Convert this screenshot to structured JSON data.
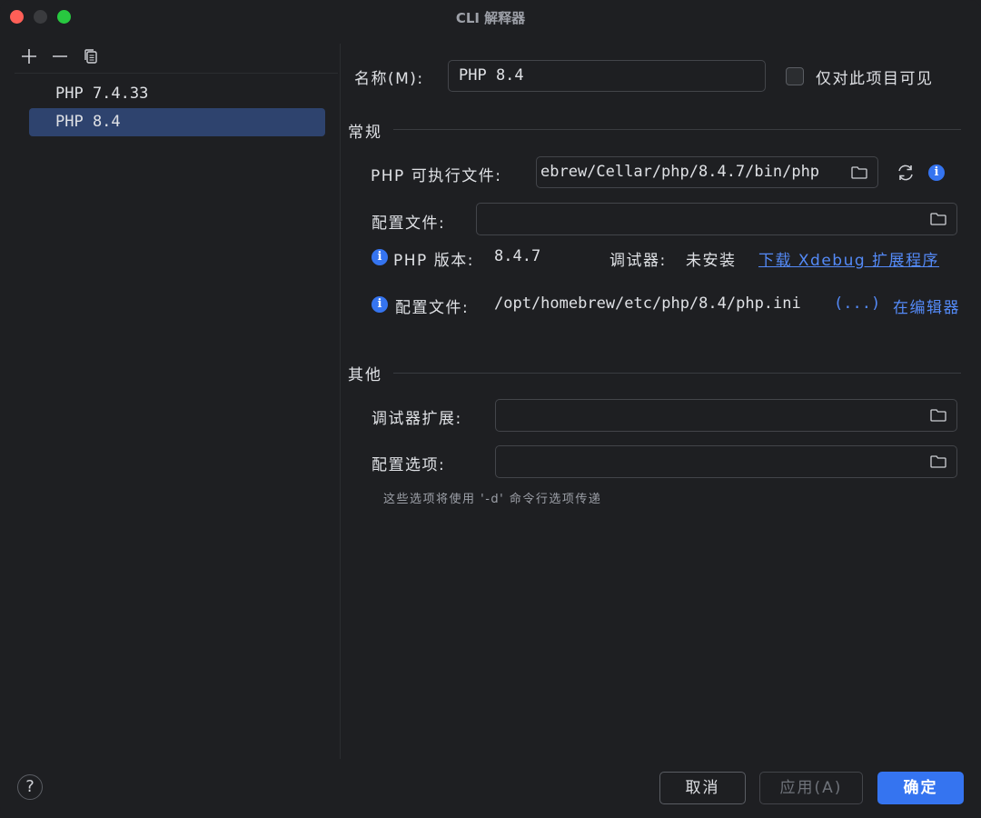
{
  "window": {
    "title": "CLI 解释器"
  },
  "left": {
    "toolbar": {
      "add": "+",
      "remove": "−"
    },
    "interpreters": [
      {
        "label": "PHP 7.4.33"
      },
      {
        "label": "PHP 8.4"
      }
    ],
    "selected_index": 1
  },
  "form": {
    "name_label": "名称(M):",
    "name_value": "PHP 8.4",
    "visible_only_label": "仅对此项目可见",
    "general_title": "常规",
    "php_exec_label": "PHP 可执行文件:",
    "php_exec_value": "ebrew/Cellar/php/8.4.7/bin/php",
    "config_file_label": "配置文件:",
    "config_file_value": "",
    "php_version_label": "PHP 版本:",
    "php_version_value": "8.4.7",
    "debugger_label": "调试器:",
    "debugger_value": "未安装",
    "download_link": "下载 Xdebug 扩展程序",
    "config_info_label": "配置文件:",
    "config_info_path": "/opt/homebrew/etc/php/8.4/php.ini",
    "config_info_more": "(...)",
    "config_info_open": "在编辑器",
    "other_title": "其他",
    "debugger_ext_label": "调试器扩展:",
    "debugger_ext_value": "",
    "config_options_label": "配置选项:",
    "config_options_value": "",
    "config_options_hint": "这些选项将使用 '-d' 命令行选项传递"
  },
  "buttons": {
    "help": "?",
    "cancel": "取消",
    "apply": "应用(A)",
    "ok": "确定"
  },
  "colors": {
    "accent": "#3574f0",
    "link": "#548af7",
    "selection": "#2e436e",
    "background": "#1e1f22"
  },
  "icons": [
    "plus-icon",
    "minus-icon",
    "copy-icon",
    "folder-icon",
    "refresh-icon",
    "info-icon",
    "help-icon"
  ]
}
